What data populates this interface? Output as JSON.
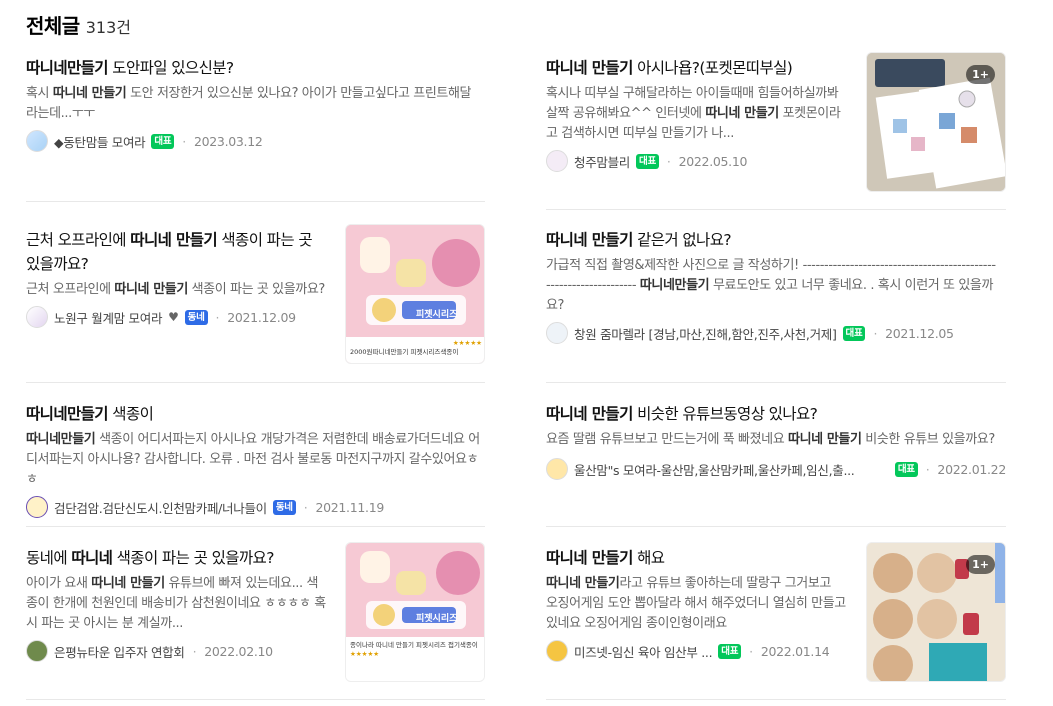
{
  "header": {
    "title": "전체글",
    "count": "313건"
  },
  "posts": [
    {
      "title_b": "따니네만들기",
      "title_rest": " 도안파일 있으신분?",
      "desc_pre": "혹시 ",
      "desc_b": "따니네 만들기",
      "desc_post": " 도안 저장한거 있으신분 있나요? 아이가 만들고싶다고 프린트해달라는데...ㅜㅜ",
      "cafe": "◆동탄맘들 모여라",
      "badge": "대표",
      "date": "2023.03.12"
    },
    {
      "title_b": "따니네 만들기",
      "title_rest": " 아시나욥?(포켓몬띠부실)",
      "desc_pre": "혹시나 띠부실 구해달라하는 아이들때매 힘들어하실까봐 살짝 공유해봐요^^ 인터넷에 ",
      "desc_b": "따니네 만들기",
      "desc_post": " 포켓몬이라고 검색하시면 띠부실 만들기가 나...",
      "cafe": "청주맘블리",
      "badge": "대표",
      "date": "2022.05.10",
      "thumb_count": "1+"
    },
    {
      "title_pre": "근처 오프라인에 ",
      "title_b": "따니네 만들기",
      "title_rest": " 색종이 파는 곳 있을까요?",
      "desc_pre": "근처 오프라인에 ",
      "desc_b": "따니네 만들기",
      "desc_post": " 색종이 파는 곳 있을까요?",
      "cafe": "노원구 월계맘 모여라",
      "heart": "♥",
      "badge": "동네",
      "date": "2021.12.09",
      "thumb_caption": "2000원따니네만들기 피젯시리즈색종이",
      "thumb_stars": "★★★★★",
      "thumb_banner": "피젯시리즈"
    },
    {
      "title_b": "따니네 만들기",
      "title_rest": " 같은거 없나요?",
      "desc_pre": "가급적 직접 촬영&제작한 사진으로 글 작성하기! ------------------------------------------------------------------ ",
      "desc_b": "따니네만들기",
      "desc_post": " 무료도안도 있고 너무 좋네요. . 혹시 이런거 또 있을까요?",
      "cafe": "창원 줌마렐라 [경남,마산,진해,함안,진주,사천,거제]",
      "badge": "대표",
      "date": "2021.12.05"
    },
    {
      "title_b": "따니네만들기",
      "title_rest": " 색종이",
      "desc_pre": "",
      "desc_b": "따니네만들기",
      "desc_post": " 색종이 어디서파는지 아시나요 개당가격은 저렴한데 배송료가더드네요 어디서파는지 아시나용? 감사합니다. 오류 . 마전 검사 불로동 마전지구까지 갈수있어요ㅎㅎ",
      "cafe": "검단검암.검단신도시.인천맘카페/너나들이",
      "badge": "동네",
      "date": "2021.11.19"
    },
    {
      "title_b": "따니네 만들기",
      "title_rest": " 비슷한 유튜브동영상 있나요?",
      "desc_pre": "요즘 딸램 유튜브보고 만드는거에 푹 빠졌네요 ",
      "desc_b": "따니네 만들기",
      "desc_post": " 비슷한 유튜브 있을까요?",
      "cafe": "울산맘\"s 모여라-울산맘,울산맘카페,울산카페,임신,출...",
      "badge": "대표",
      "date": "2022.01.22"
    },
    {
      "title_pre": "동네에 ",
      "title_b": "따니네",
      "title_rest": " 색종이 파는 곳 있을까요?",
      "desc_pre": "아이가 요새 ",
      "desc_b": "따니네 만들기",
      "desc_post": " 유튜브에 빠져 있는데요... 색종이 한개에 천원인데 배송비가 삼천원이네요 ㅎㅎㅎㅎ 혹시 파는 곳 아시는 분 계실까...",
      "cafe": "은평뉴타운 입주자 연합회",
      "date": "2022.02.10",
      "thumb_caption": "종이나라 따니네 만들기 피젯시리즈 접기색종이",
      "thumb_stars": "★★★★★",
      "thumb_banner": "피젯시리즈"
    },
    {
      "title_b": "따니네 만들기",
      "title_rest": " 해요",
      "desc_pre": "",
      "desc_b": "따니네 만들기",
      "desc_post": "라고 유튜브 좋아하는데 딸랑구 그거보고 오징어게임 도안 뽑아달라 해서 해주었더니 열심히 만들고 있네요 오징어게임 종이인형이래요",
      "cafe": "미즈넷-임신 육아 임산부 ...",
      "badge": "대표",
      "date": "2022.01.14",
      "thumb_count": "1+"
    }
  ],
  "colors": {
    "naver_green": "#03c75a",
    "local_blue": "#2e6be6",
    "divider": "#e8e8e8"
  }
}
